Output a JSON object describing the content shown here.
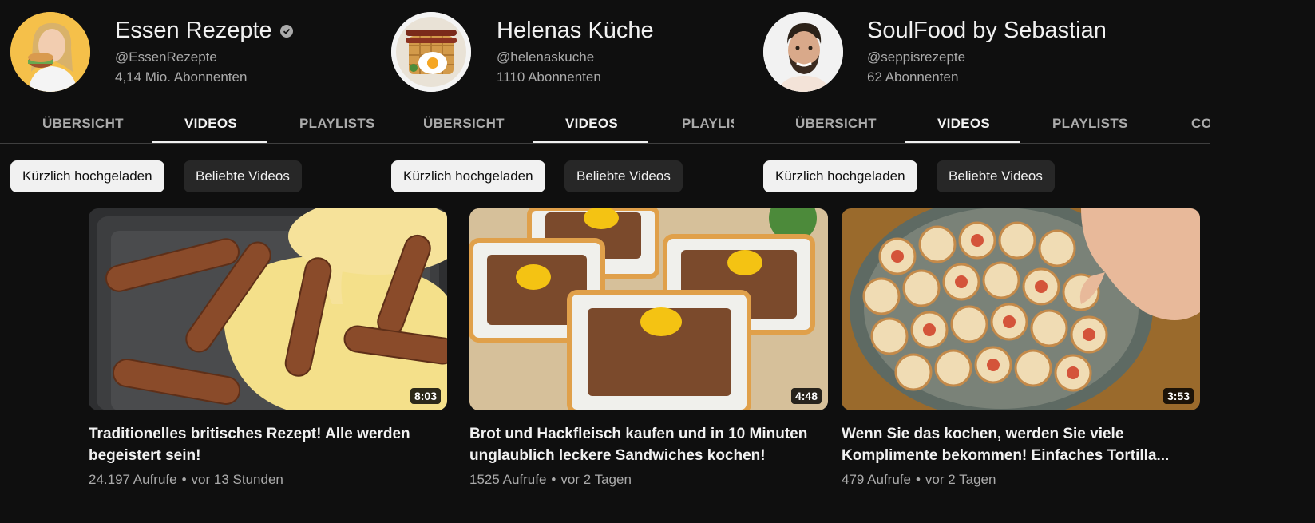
{
  "channels": [
    {
      "name": "Essen Rezepte",
      "verified": true,
      "handle": "@EssenRezepte",
      "subscribers": "4,14 Mio. Abonnenten",
      "tabs": [
        "ÜBERSICHT",
        "VIDEOS",
        "PLAYLISTS"
      ],
      "active_tab": "VIDEOS",
      "chips": [
        "Kürzlich hochgeladen",
        "Beliebte Videos"
      ],
      "selected_chip": "Kürzlich hochgeladen",
      "avatar_bg": "#f5c04a"
    },
    {
      "name": "Helenas Küche",
      "verified": false,
      "handle": "@helenaskuche",
      "subscribers": "1110 Abonnenten",
      "tabs": [
        "ÜBERSICHT",
        "VIDEOS",
        "PLAYLIS"
      ],
      "active_tab": "VIDEOS",
      "chips": [
        "Kürzlich hochgeladen",
        "Beliebte Videos"
      ],
      "selected_chip": "Kürzlich hochgeladen",
      "avatar_bg": "#f4f4f4"
    },
    {
      "name": "SoulFood by Sebastian",
      "verified": false,
      "handle": "@seppisrezepte",
      "subscribers": "62 Abonnenten",
      "tabs": [
        "ÜBERSICHT",
        "VIDEOS",
        "PLAYLISTS",
        "CO"
      ],
      "active_tab": "VIDEOS",
      "chips": [
        "Kürzlich hochgeladen",
        "Beliebte Videos"
      ],
      "selected_chip": "Kürzlich hochgeladen",
      "avatar_bg": "#f2f2f2"
    }
  ],
  "videos": [
    {
      "title": "Traditionelles britisches Rezept! Alle werden begeistert sein!",
      "views": "24.197 Aufrufe",
      "age": "vor 13 Stunden",
      "duration": "8:03"
    },
    {
      "title": "Brot und Hackfleisch kaufen und in 10 Minuten unglaublich leckere Sandwiches kochen!",
      "views": "1525 Aufrufe",
      "age": "vor 2 Tagen",
      "duration": "4:48"
    },
    {
      "title": "Wenn Sie das kochen, werden Sie viele Komplimente bekommen! Einfaches Tortilla...",
      "views": "479 Aufrufe",
      "age": "vor 2 Tagen",
      "duration": "3:53"
    }
  ],
  "colors": {
    "background": "#0f0f0f",
    "text_primary": "#f1f1f1",
    "text_secondary": "#aaaaaa",
    "chip_bg": "#272727",
    "chip_selected_bg": "#f1f1f1"
  }
}
